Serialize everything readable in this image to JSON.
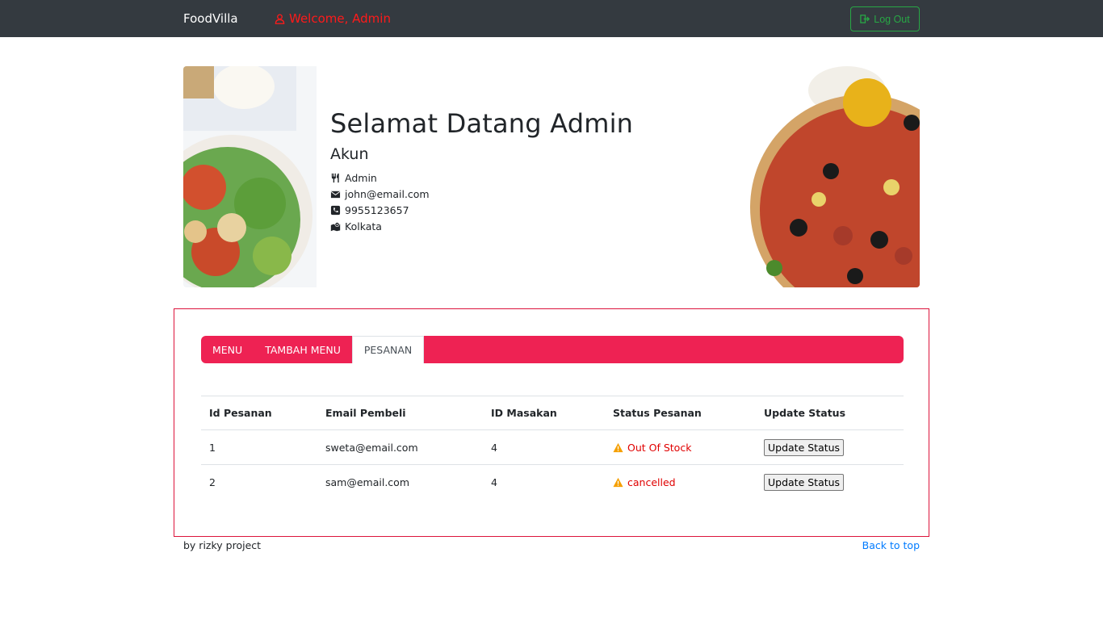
{
  "navbar": {
    "brand": "FoodVilla",
    "welcome": "Welcome, Admin",
    "logout_label": "Log Out"
  },
  "banner": {
    "title": "Selamat Datang Admin",
    "subtitle": "Akun",
    "info": [
      {
        "icon": "utensils-icon",
        "text": "Admin"
      },
      {
        "icon": "envelope-icon",
        "text": "john@email.com"
      },
      {
        "icon": "phone-icon",
        "text": "9955123657"
      },
      {
        "icon": "map-icon",
        "text": "Kolkata"
      }
    ]
  },
  "tabs": [
    {
      "label": "MENU"
    },
    {
      "label": "TAMBAH MENU"
    },
    {
      "label": "PESANAN",
      "active": true
    }
  ],
  "orders": {
    "headers": [
      "Id Pesanan",
      "Email Pembeli",
      "ID Masakan",
      "Status Pesanan",
      "Update Status"
    ],
    "rows": [
      {
        "id": "1",
        "email": "sweta@email.com",
        "dish_id": "4",
        "status": "Out Of Stock",
        "button": "Update Status"
      },
      {
        "id": "2",
        "email": "sam@email.com",
        "dish_id": "4",
        "status": "cancelled",
        "button": "Update Status"
      }
    ]
  },
  "footer": {
    "credit": "by rizky project",
    "back_to_top": "Back to top"
  },
  "colors": {
    "navbar_bg": "#343a40",
    "tab_bar": "#ee2253",
    "panel_border": "#dc143c",
    "logout_green": "#28a745",
    "status_red": "#e00000",
    "warning_orange": "#f59f00",
    "link_blue": "#007bff"
  }
}
